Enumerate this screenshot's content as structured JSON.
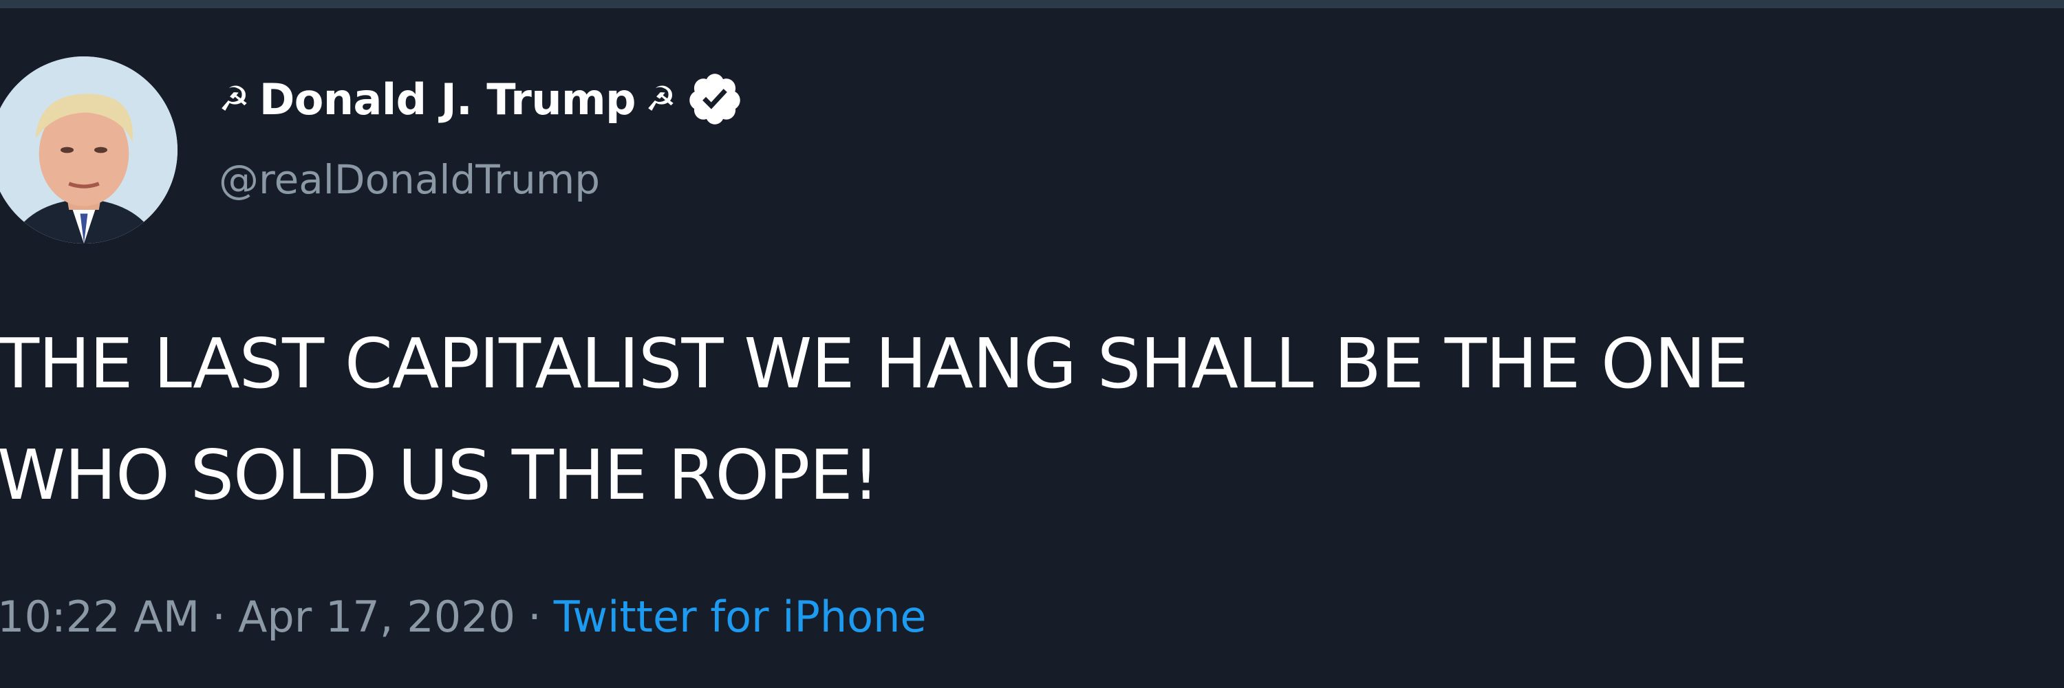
{
  "tweet": {
    "display_name": "Donald J. Trump",
    "name_decoration_left": "☭",
    "name_decoration_right": "☭",
    "handle": "@realDonaldTrump",
    "verified": true,
    "text_lines": [
      "THE LAST CAPITALIST WE HANG SHALL BE THE ONE",
      "WHO SOLD US THE ROPE!"
    ],
    "time": "10:22 AM",
    "date": "Apr 17, 2020",
    "separator": "·",
    "source": "Twitter for iPhone"
  },
  "icons": {
    "avatar": "profile-photo",
    "verified": "verified-badge-icon"
  },
  "colors": {
    "background": "#161d29",
    "text": "#ffffff",
    "secondary": "#8b98a5",
    "link": "#1d9bf0"
  }
}
